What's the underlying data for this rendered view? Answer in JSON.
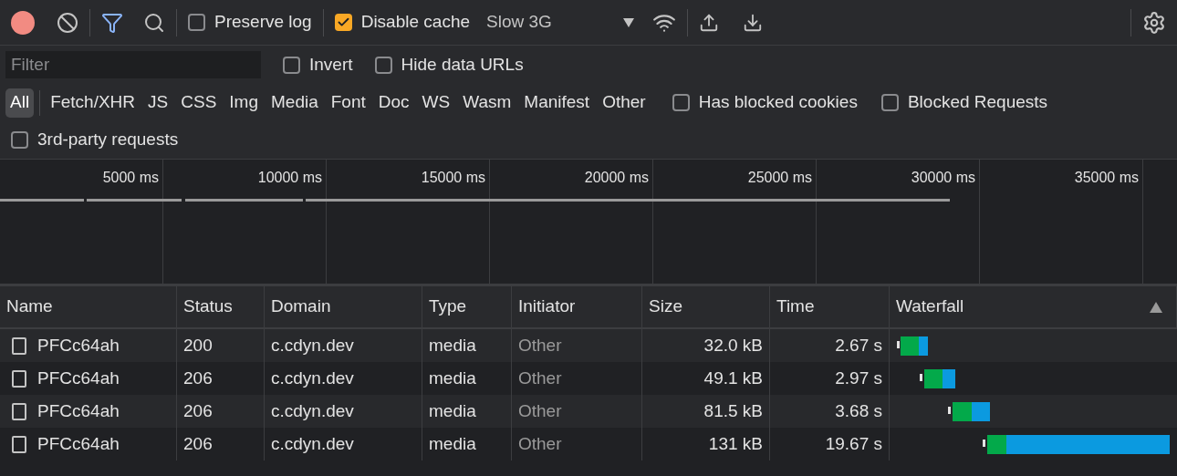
{
  "toolbar": {
    "recording": true,
    "preserve_log": {
      "label": "Preserve log",
      "checked": false
    },
    "disable_cache": {
      "label": "Disable cache",
      "checked": true
    },
    "throttling": "Slow 3G"
  },
  "filter_bar": {
    "placeholder": "Filter",
    "invert": {
      "label": "Invert",
      "checked": false
    },
    "hide_data_urls": {
      "label": "Hide data URLs",
      "checked": false
    }
  },
  "type_filters": [
    {
      "label": "All",
      "selected": true
    },
    {
      "label": "Fetch/XHR",
      "selected": false
    },
    {
      "label": "JS",
      "selected": false
    },
    {
      "label": "CSS",
      "selected": false
    },
    {
      "label": "Img",
      "selected": false
    },
    {
      "label": "Media",
      "selected": false
    },
    {
      "label": "Font",
      "selected": false
    },
    {
      "label": "Doc",
      "selected": false
    },
    {
      "label": "WS",
      "selected": false
    },
    {
      "label": "Wasm",
      "selected": false
    },
    {
      "label": "Manifest",
      "selected": false
    },
    {
      "label": "Other",
      "selected": false
    }
  ],
  "extra_filters": [
    {
      "label": "Has blocked cookies",
      "checked": false
    },
    {
      "label": "Blocked Requests",
      "checked": false
    },
    {
      "label": "3rd-party requests",
      "checked": false
    }
  ],
  "timeline_ticks": [
    "5000 ms",
    "10000 ms",
    "15000 ms",
    "20000 ms",
    "25000 ms",
    "30000 ms",
    "35000 ms"
  ],
  "table": {
    "columns": [
      {
        "label": "Name",
        "sorted": false
      },
      {
        "label": "Status",
        "sorted": false
      },
      {
        "label": "Domain",
        "sorted": false
      },
      {
        "label": "Type",
        "sorted": false
      },
      {
        "label": "Initiator",
        "sorted": false
      },
      {
        "label": "Size",
        "sorted": false
      },
      {
        "label": "Time",
        "sorted": false
      },
      {
        "label": "Waterfall",
        "sorted": true
      }
    ],
    "rows": [
      {
        "name": "PFCc64ah",
        "status": "200",
        "domain": "c.cdyn.dev",
        "type": "media",
        "initiator": "Other",
        "size": "32.0 kB",
        "time": "2.67 s"
      },
      {
        "name": "PFCc64ah",
        "status": "206",
        "domain": "c.cdyn.dev",
        "type": "media",
        "initiator": "Other",
        "size": "49.1 kB",
        "time": "2.97 s"
      },
      {
        "name": "PFCc64ah",
        "status": "206",
        "domain": "c.cdyn.dev",
        "type": "media",
        "initiator": "Other",
        "size": "81.5 kB",
        "time": "3.68 s"
      },
      {
        "name": "PFCc64ah",
        "status": "206",
        "domain": "c.cdyn.dev",
        "type": "media",
        "initiator": "Other",
        "size": "131 kB",
        "time": "19.67 s"
      }
    ]
  }
}
